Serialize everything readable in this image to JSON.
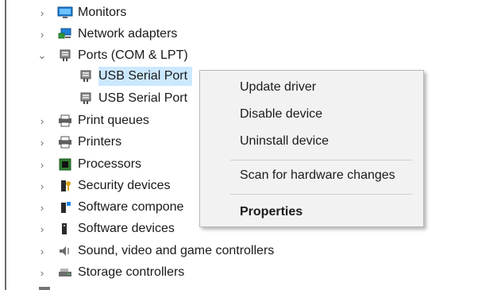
{
  "tree": {
    "items": [
      {
        "label": "Monitors",
        "icon": "monitor-icon",
        "expanded": false
      },
      {
        "label": "Network adapters",
        "icon": "network-adapter-icon",
        "expanded": false
      },
      {
        "label": "Ports (COM & LPT)",
        "icon": "port-icon",
        "expanded": true
      },
      {
        "label": "USB Serial Port",
        "icon": "port-icon",
        "child": true,
        "selected": true
      },
      {
        "label": "USB Serial Port",
        "icon": "port-icon",
        "child": true
      },
      {
        "label": "Print queues",
        "icon": "printer-icon",
        "expanded": false
      },
      {
        "label": "Printers",
        "icon": "printer-icon",
        "expanded": false
      },
      {
        "label": "Processors",
        "icon": "processor-icon",
        "expanded": false
      },
      {
        "label": "Security devices",
        "icon": "security-device-icon",
        "expanded": false
      },
      {
        "label": "Software compone",
        "icon": "software-component-icon",
        "expanded": false
      },
      {
        "label": "Software devices",
        "icon": "software-device-icon",
        "expanded": false
      },
      {
        "label": "Sound, video and game controllers",
        "icon": "speaker-icon",
        "expanded": false
      },
      {
        "label": "Storage controllers",
        "icon": "storage-controller-icon",
        "expanded": false
      }
    ]
  },
  "context_menu": {
    "update_driver": "Update driver",
    "disable_device": "Disable device",
    "uninstall_device": "Uninstall device",
    "scan_hardware": "Scan for hardware changes",
    "properties": "Properties"
  },
  "colors": {
    "selection": "#cce8ff",
    "menu_background": "#f2f2f2",
    "monitor": "#1e7fd6",
    "network": "#1e7fd6",
    "processor": "#2f7d32"
  }
}
